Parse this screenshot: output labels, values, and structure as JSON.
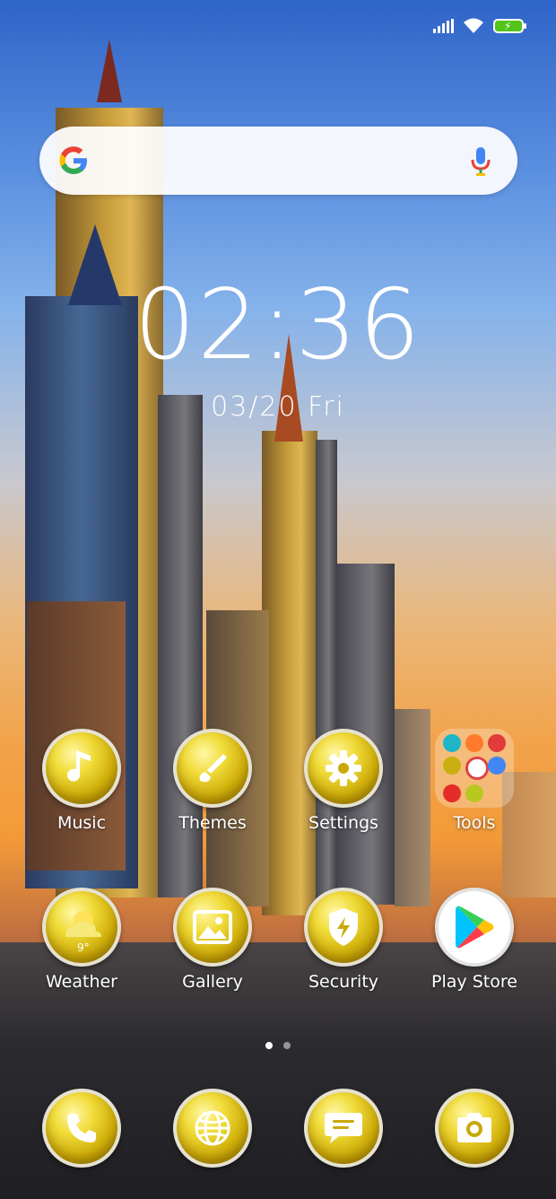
{
  "status_bar": {
    "signal_icon": "cellular-signal-icon",
    "wifi_icon": "wifi-icon",
    "battery_icon": "battery-charging-icon"
  },
  "search_bar": {
    "logo": "google-logo-icon",
    "mic": "mic-icon"
  },
  "clock": {
    "time": "02:36",
    "date": "03/20 Fri"
  },
  "apps_row1": [
    {
      "label": "Music",
      "icon": "music-note-icon"
    },
    {
      "label": "Themes",
      "icon": "paintbrush-icon"
    },
    {
      "label": "Settings",
      "icon": "gear-icon"
    },
    {
      "label": "Tools",
      "icon": "folder-icon"
    }
  ],
  "apps_row2": [
    {
      "label": "Weather",
      "icon": "weather-icon",
      "temp": "9°"
    },
    {
      "label": "Gallery",
      "icon": "image-icon"
    },
    {
      "label": "Security",
      "icon": "shield-bolt-icon"
    },
    {
      "label": "Play Store",
      "icon": "play-store-icon"
    }
  ],
  "page_indicator": {
    "pages": 2,
    "current": 1
  },
  "dock": [
    {
      "icon": "phone-icon"
    },
    {
      "icon": "globe-icon"
    },
    {
      "icon": "message-icon"
    },
    {
      "icon": "camera-icon"
    }
  ],
  "colors": {
    "accent_gold": "#e2c51c",
    "battery_green": "#52c41a"
  }
}
